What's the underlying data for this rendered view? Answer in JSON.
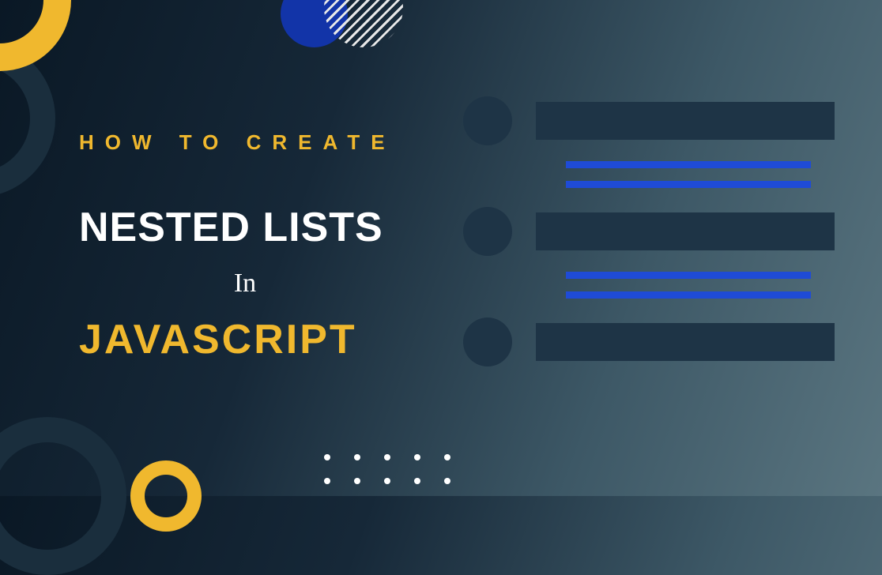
{
  "heading": {
    "line1": "HOW TO CREATE",
    "line2": "NESTED LISTS",
    "line3": "In",
    "line4": "JAVASCRIPT"
  },
  "colors": {
    "accent_yellow": "#f0b82e",
    "accent_blue": "#1f4bd6",
    "dark_shape": "#1e3446",
    "text_white": "#ffffff"
  },
  "list_graphic": {
    "items": 3,
    "sublines_per_item": 2
  }
}
